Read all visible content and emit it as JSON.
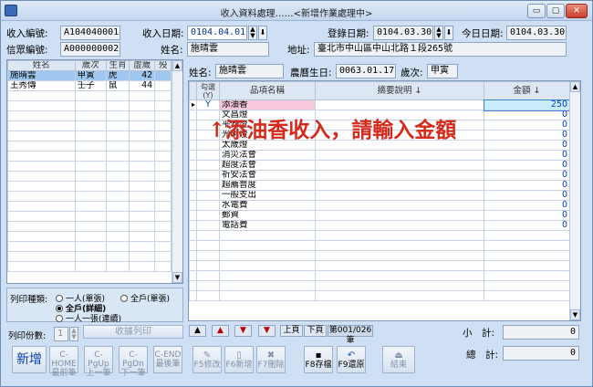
{
  "window": {
    "title": "收入資料處理……<新增作業處理中>",
    "min": "▭",
    "max": "▢",
    "close": "✕"
  },
  "header": {
    "receipt_no_label": "收入編號:",
    "receipt_no": "A104040001",
    "receipt_date_label": "收入日期:",
    "receipt_date": "0104.04.01",
    "reg_date_label": "登錄日期:",
    "reg_date": "0104.03.30",
    "today_label": "今日日期:",
    "today": "0104.03.30",
    "believer_no_label": "信眾編號:",
    "believer_no": "A000000002",
    "name_label": "姓名:",
    "name": "施晴雲",
    "addr_label": "地址:",
    "addr": "臺北市中山區中山北路１段265號"
  },
  "member_grid": {
    "columns": [
      "姓名",
      "歲次",
      "生肖",
      "虛歲",
      "殁"
    ],
    "rows": [
      {
        "name": "施晴雲",
        "year": "甲寅",
        "zodiac": "虎",
        "age": "42",
        "dead": ""
      },
      {
        "name": "王秀傳",
        "year": "壬子",
        "zodiac": "鼠",
        "age": "44",
        "dead": ""
      }
    ]
  },
  "print": {
    "type_label": "列印種類:",
    "opt1": "一人(單張)",
    "opt2": "全戶(單張)",
    "opt3": "全戶(詳細)",
    "opt4": "一人一張(連續)",
    "copies_label": "列印份數:",
    "copies": "1",
    "print_btn": "收據列印"
  },
  "detail": {
    "name_label": "姓名:",
    "name": "施晴雲",
    "birth_label": "農曆生日:",
    "birth": "0063.01.17",
    "year_label": "歲次:",
    "year": "甲寅",
    "columns": [
      "勾選\n(Y)",
      "品項名稱",
      "摘要說明 ↓",
      "金額 ↓"
    ],
    "items": [
      {
        "check": "Y",
        "name": "添油香",
        "note": "",
        "amount": "250"
      },
      {
        "check": "",
        "name": "文昌燈",
        "note": "",
        "amount": "0"
      },
      {
        "check": "",
        "name": "平安燈",
        "note": "",
        "amount": "0"
      },
      {
        "check": "",
        "name": "光明燈",
        "note": "",
        "amount": "0"
      },
      {
        "check": "",
        "name": "太歲燈",
        "note": "",
        "amount": "0"
      },
      {
        "check": "",
        "name": "消災法會",
        "note": "",
        "amount": "0"
      },
      {
        "check": "",
        "name": "超度法會",
        "note": "",
        "amount": "0"
      },
      {
        "check": "",
        "name": "祈安法會",
        "note": "",
        "amount": "0"
      },
      {
        "check": "",
        "name": "超薦普度",
        "note": "",
        "amount": "0"
      },
      {
        "check": "",
        "name": "一般支出",
        "note": "",
        "amount": "0"
      },
      {
        "check": "",
        "name": "水電費",
        "note": "",
        "amount": "0"
      },
      {
        "check": "",
        "name": "郵資",
        "note": "",
        "amount": "0"
      },
      {
        "check": "",
        "name": "電話費",
        "note": "",
        "amount": "0"
      }
    ],
    "annotation": "↑添油香收入，請輸入金額",
    "nav_prev_page": "上頁",
    "nav_next_page": "下頁",
    "page": "第001/026筆",
    "subtotal_label": "小　計:",
    "subtotal": "0",
    "total_label": "總　計:",
    "total": "0"
  },
  "toolbar": {
    "add": "新增",
    "first_k": "C-HOME",
    "first": "最前筆",
    "prev_k": "C-PgUp",
    "prev": "上一筆",
    "next_k": "C-PgDn",
    "next": "下一筆",
    "last_k": "C-END",
    "last": "最後筆",
    "f5": "F5修改",
    "f6": "F6新增",
    "f7": "F7刪除",
    "f8": "F8存檔",
    "f9": "F9還原",
    "exit": "結束"
  }
}
